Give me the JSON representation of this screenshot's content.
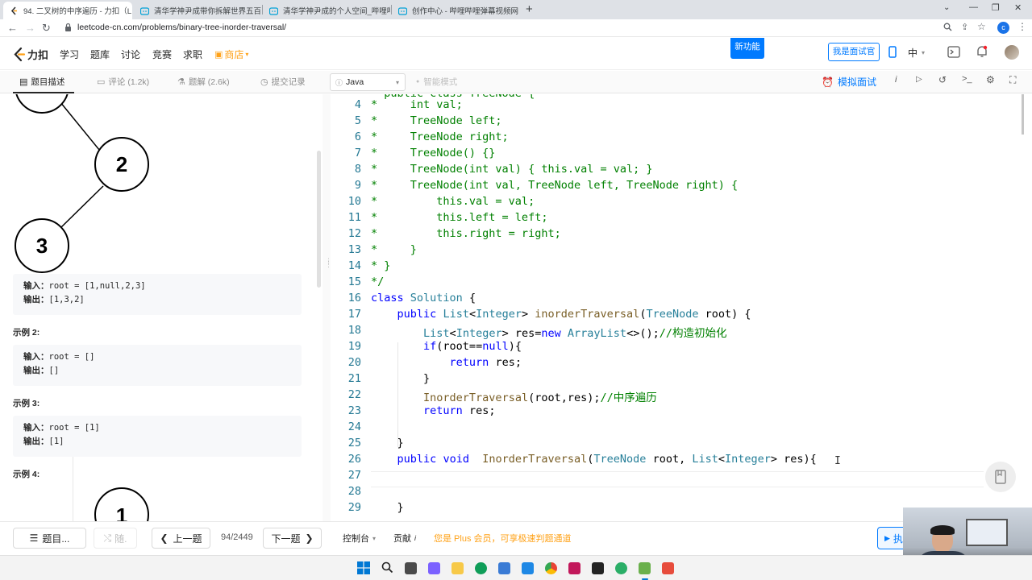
{
  "browser": {
    "tabs": [
      {
        "title": "94. 二叉树的中序遍历 - 力扣（L",
        "active": true,
        "close": "✕"
      },
      {
        "title": "清华学神尹成带你拆解世界五百",
        "active": false,
        "close": "✕"
      },
      {
        "title": "清华学神尹成的个人空间_哔哩哔",
        "active": false,
        "close": "✕"
      },
      {
        "title": "创作中心 - 哔哩哔哩弹幕视频网",
        "active": false,
        "close": "✕"
      }
    ],
    "new_tab": "+",
    "url": "leetcode-cn.com/problems/binary-tree-inorder-traversal/",
    "profile_initial": "c"
  },
  "site": {
    "logo_text": "力扣",
    "nav": [
      "学习",
      "题库",
      "讨论",
      "竞赛",
      "求职"
    ],
    "shop": "商店",
    "new_feature_badge": "新功能",
    "interviewer_button": "我是面试官",
    "language": "中"
  },
  "subbar": {
    "tabs": [
      "题目描述",
      "评论 (1.2k)",
      "题解 (2.6k)",
      "提交记录"
    ],
    "language_select": "Java",
    "smart_mode": "智能模式",
    "mock_interview": "模拟面试"
  },
  "problem": {
    "tree1": {
      "nodes": [
        "2",
        "3"
      ]
    },
    "examples": [
      {
        "label": "",
        "input_label": "输入：",
        "input": "root = [1,null,2,3]",
        "output_label": "输出：",
        "output": "[1,3,2]"
      },
      {
        "label": "示例 2:",
        "input_label": "输入：",
        "input": "root = []",
        "output_label": "输出：",
        "output": "[]"
      },
      {
        "label": "示例 3:",
        "input_label": "输入：",
        "input": "root = [1]",
        "output_label": "输出：",
        "output": "[1]"
      }
    ],
    "example4_label": "示例 4:",
    "tree4": {
      "nodes": [
        "1"
      ]
    }
  },
  "editor": {
    "lines": [
      {
        "n": "4",
        "html": "<span class='cm'>*     int val;</span>"
      },
      {
        "n": "5",
        "html": "<span class='cm'>*     TreeNode left;</span>"
      },
      {
        "n": "6",
        "html": "<span class='cm'>*     TreeNode right;</span>"
      },
      {
        "n": "7",
        "html": "<span class='cm'>*     TreeNode() {}</span>"
      },
      {
        "n": "8",
        "html": "<span class='cm'>*     TreeNode(int val) { this.val = val; }</span>"
      },
      {
        "n": "9",
        "html": "<span class='cm'>*     TreeNode(int val, TreeNode left, TreeNode right) {</span>"
      },
      {
        "n": "10",
        "html": "<span class='cm'>*         this.val = val;</span>"
      },
      {
        "n": "11",
        "html": "<span class='cm'>*         this.left = left;</span>"
      },
      {
        "n": "12",
        "html": "<span class='cm'>*         this.right = right;</span>"
      },
      {
        "n": "13",
        "html": "<span class='cm'>*     }</span>"
      },
      {
        "n": "14",
        "html": "<span class='cm'>* }</span>"
      },
      {
        "n": "15",
        "html": "<span class='cm'>*/</span>"
      },
      {
        "n": "16",
        "html": "<span class='kw'>class</span> <span class='ty'>Solution</span> {"
      },
      {
        "n": "17",
        "html": "    <span class='kw'>public</span> <span class='ty'>List</span>&lt;<span class='ty'>Integer</span>&gt; <span class='fn'>inorderTraversal</span>(<span class='ty'>TreeNode</span> root) {"
      },
      {
        "n": "18",
        "html": "        <span class='ty'>List</span>&lt;<span class='ty'>Integer</span>&gt; res=<span class='kw'>new</span> <span class='ty'>ArrayList</span>&lt;&gt;();<span class='cm'>//构造初始化</span>"
      },
      {
        "n": "19",
        "html": "        <span class='kw'>if</span>(root==<span class='kw'>null</span>){"
      },
      {
        "n": "20",
        "html": "            <span class='kw'>return</span> res;"
      },
      {
        "n": "21",
        "html": "        }"
      },
      {
        "n": "22",
        "html": "        <span class='fn'>InorderTraversal</span>(root,res);<span class='cm'>//中序遍历</span>"
      },
      {
        "n": "23",
        "html": "        <span class='kw'>return</span> res;"
      },
      {
        "n": "24",
        "html": ""
      },
      {
        "n": "25",
        "html": "    }"
      },
      {
        "n": "26",
        "html": "    <span class='kw'>public</span> <span class='kw'>void</span>  <span class='fn'>InorderTraversal</span>(<span class='ty'>TreeNode</span> root, <span class='ty'>List</span>&lt;<span class='ty'>Integer</span>&gt; res){"
      },
      {
        "n": "27",
        "html": ""
      },
      {
        "n": "28",
        "html": ""
      },
      {
        "n": "29",
        "html": "    }"
      }
    ],
    "cursor_glyph": "I"
  },
  "bottombar": {
    "catalog": "题目...",
    "random": "随.",
    "prev": "上一题",
    "progress": "94/2449",
    "next": "下一题",
    "console": "控制台",
    "contribute": "贡献",
    "plus_text": "您是 Plus 会员，可享极速判题通道",
    "run_partial": "执"
  },
  "colors": {
    "accent": "#007aff",
    "plus": "#ffa116",
    "editor_line_number": "#237893"
  }
}
